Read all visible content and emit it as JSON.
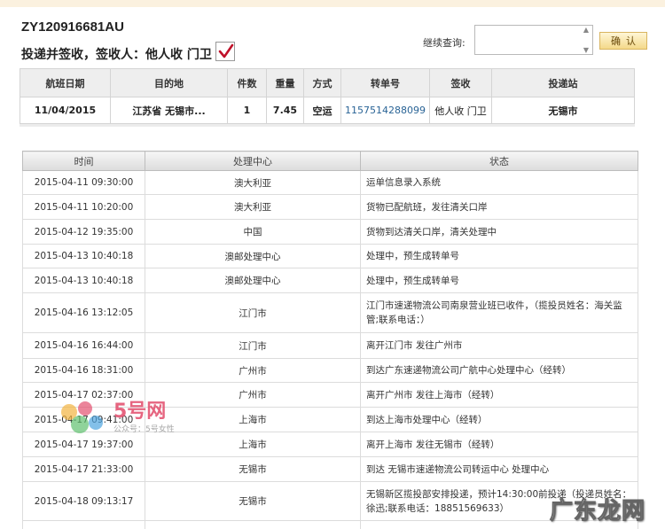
{
  "header": {
    "tracking_number": "ZY120916681AU",
    "sign_status": "投递并签收，签收人：他人收 门卫"
  },
  "query": {
    "label": "继续查询:",
    "input_value": "",
    "confirm_label": "确认"
  },
  "flight": {
    "columns": [
      "航班日期",
      "目的地",
      "件数",
      "重量",
      "方式",
      "转单号",
      "签收",
      "投递站"
    ],
    "row": [
      "11/04/2015",
      "江苏省 无锡市...",
      "1",
      "7.45",
      "空运",
      "1157514288099",
      "他人收 门卫",
      "无锡市"
    ]
  },
  "trace": {
    "columns": [
      "时间",
      "处理中心",
      "状态"
    ],
    "rows": [
      {
        "time": "2015-04-11 09:30:00",
        "center": "澳大利亚",
        "status": "运单信息录入系统"
      },
      {
        "time": "2015-04-11 10:20:00",
        "center": "澳大利亚",
        "status": "货物已配航班，发往清关口岸"
      },
      {
        "time": "2015-04-12 19:35:00",
        "center": "中国",
        "status": "货物到达清关口岸，清关处理中"
      },
      {
        "time": "2015-04-13 10:40:18",
        "center": "澳邮处理中心",
        "status": "处理中，预生成转单号"
      },
      {
        "time": "2015-04-13 10:40:18",
        "center": "澳邮处理中心",
        "status": "处理中，预生成转单号"
      },
      {
        "time": "2015-04-16 13:12:05",
        "center": "江门市",
        "status": "江门市速递物流公司南泉营业班已收件，（揽投员姓名：海关监管;联系电话：）"
      },
      {
        "time": "2015-04-16 16:44:00",
        "center": "江门市",
        "status": "离开江门市 发往广州市"
      },
      {
        "time": "2015-04-16 18:31:00",
        "center": "广州市",
        "status": "到达广东速递物流公司广航中心处理中心（经转）"
      },
      {
        "time": "2015-04-17 02:37:00",
        "center": "广州市",
        "status": "离开广州市 发往上海市（经转）"
      },
      {
        "time": "2015-04-17 09:41:00",
        "center": "上海市",
        "status": "到达上海市处理中心（经转）"
      },
      {
        "time": "2015-04-17 19:37:00",
        "center": "上海市",
        "status": "离开上海市 发往无锡市（经转）"
      },
      {
        "time": "2015-04-17 21:33:00",
        "center": "无锡市",
        "status": "到达 无锡市速递物流公司转运中心 处理中心"
      },
      {
        "time": "2015-04-18 09:13:17",
        "center": "无锡市",
        "status": "无锡新区揽投部安排投递，预计14:30:00前投递（投递员姓名：徐迅;联系电话：18851569633）"
      },
      {
        "time": "",
        "center": "",
        "status": ""
      }
    ]
  },
  "watermarks": {
    "left_title": "5号网",
    "left_sub": "公众号：5号女性",
    "right_text": "广东龙网"
  }
}
